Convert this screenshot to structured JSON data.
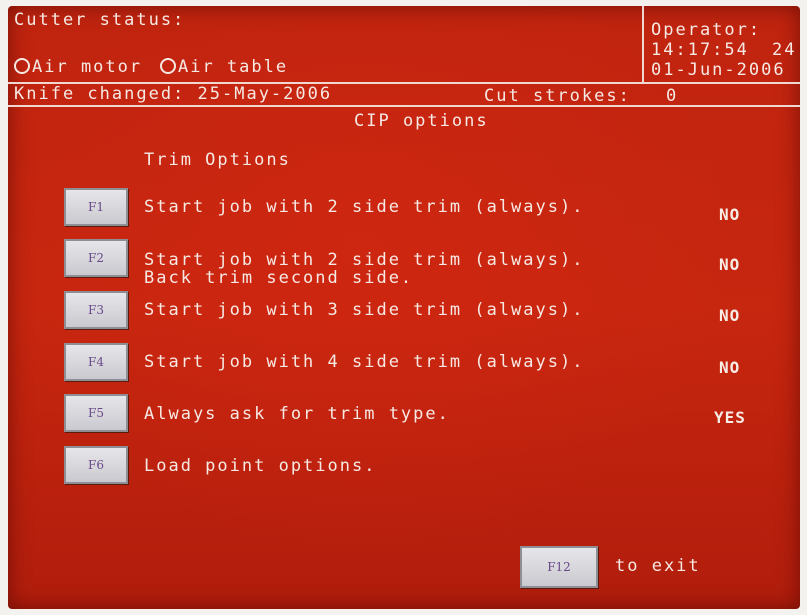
{
  "header": {
    "cutter_status_label": "Cutter status:",
    "air_motor_label": "Air motor",
    "air_table_label": "Air table",
    "operator_label": "Operator:",
    "time": "14:17:54",
    "time_suffix": "24",
    "date": "01-Jun-2006",
    "knife_changed": "Knife changed: 25-May-2006",
    "cut_strokes_label": "Cut strokes:",
    "cut_strokes_value": "0"
  },
  "page_title": "CIP options",
  "section_title": "Trim Options",
  "options": [
    {
      "key": "F1",
      "text": "Start job with 2 side trim (always).",
      "value": "NO"
    },
    {
      "key": "F2",
      "text": "Start job with 2 side trim (always).",
      "text2": "Back trim second side.",
      "value": "NO"
    },
    {
      "key": "F3",
      "text": "Start job with 3 side trim (always).",
      "value": "NO"
    },
    {
      "key": "F4",
      "text": "Start job with 4 side trim (always).",
      "value": "NO"
    },
    {
      "key": "F5",
      "text": "Always ask for trim type.",
      "value": "YES"
    },
    {
      "key": "F6",
      "text": "Load point options.",
      "value": ""
    }
  ],
  "exit": {
    "key": "F12",
    "label": "to exit"
  },
  "colors": {
    "screen_bg": "#c0240f",
    "key_bg": "#d8d8dd"
  }
}
